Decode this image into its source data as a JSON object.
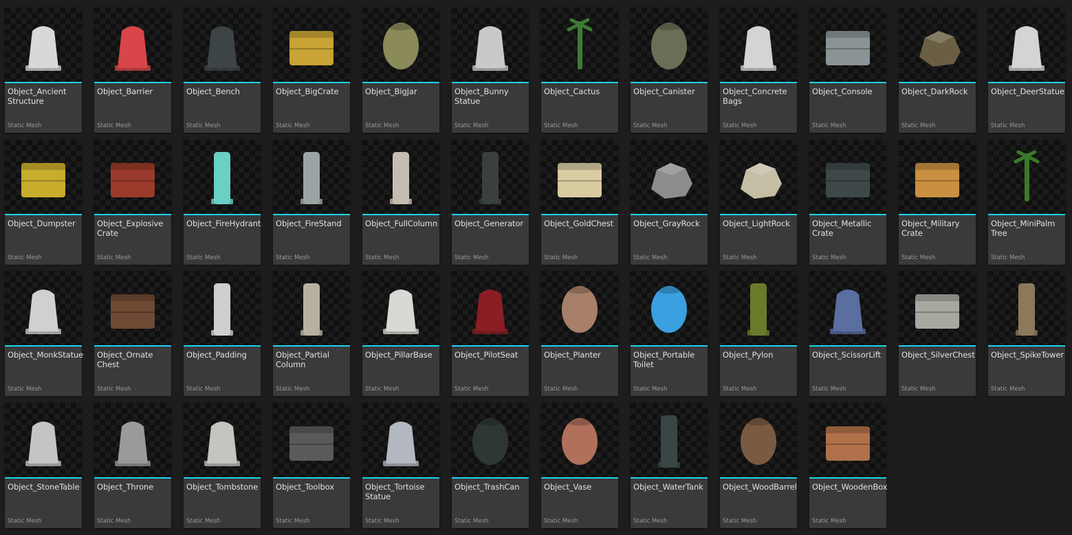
{
  "content_browser": {
    "assets": [
      {
        "name": "Object_Ancient Structure",
        "type": "Static Mesh",
        "icon": "ancient-structure-icon",
        "color": "#d8d8d8"
      },
      {
        "name": "Object_Barrier",
        "type": "Static Mesh",
        "icon": "barrier-icon",
        "color": "#d8454a"
      },
      {
        "name": "Object_Bench",
        "type": "Static Mesh",
        "icon": "bench-icon",
        "color": "#3c4446"
      },
      {
        "name": "Object_BigCrate",
        "type": "Static Mesh",
        "icon": "crate-icon",
        "color": "#c8a335"
      },
      {
        "name": "Object_BigJar",
        "type": "Static Mesh",
        "icon": "jar-icon",
        "color": "#8a8a5a"
      },
      {
        "name": "Object_Bunny Statue",
        "type": "Static Mesh",
        "icon": "bunny-statue-icon",
        "color": "#c9c9c9"
      },
      {
        "name": "Object_Cactus",
        "type": "Static Mesh",
        "icon": "cactus-icon",
        "color": "#3c7a32"
      },
      {
        "name": "Object_Canister",
        "type": "Static Mesh",
        "icon": "canister-icon",
        "color": "#6a6e56"
      },
      {
        "name": "Object_Concrete Bags",
        "type": "Static Mesh",
        "icon": "concrete-bags-icon",
        "color": "#d4d4d4"
      },
      {
        "name": "Object_Console",
        "type": "Static Mesh",
        "icon": "console-icon",
        "color": "#8a9396"
      },
      {
        "name": "Object_DarkRock",
        "type": "Static Mesh",
        "icon": "rock-icon",
        "color": "#6a5e44"
      },
      {
        "name": "Object_DeerStatue",
        "type": "Static Mesh",
        "icon": "deer-statue-icon",
        "color": "#d4d4d4"
      },
      {
        "name": "Object_Dumpster",
        "type": "Static Mesh",
        "icon": "dumpster-icon",
        "color": "#c8ac2c"
      },
      {
        "name": "Object_Explosive Crate",
        "type": "Static Mesh",
        "icon": "explosive-crate-icon",
        "color": "#9a3a2a"
      },
      {
        "name": "Object_FireHydrant",
        "type": "Static Mesh",
        "icon": "fire-hydrant-icon",
        "color": "#6ad0c4"
      },
      {
        "name": "Object_FireStand",
        "type": "Static Mesh",
        "icon": "fire-stand-icon",
        "color": "#9aa4a4"
      },
      {
        "name": "Object_FullColumn",
        "type": "Static Mesh",
        "icon": "column-icon",
        "color": "#c4bdb0"
      },
      {
        "name": "Object_Generator",
        "type": "Static Mesh",
        "icon": "generator-icon",
        "color": "#3a4040"
      },
      {
        "name": "Object_GoldChest",
        "type": "Static Mesh",
        "icon": "chest-icon",
        "color": "#d8cba0"
      },
      {
        "name": "Object_GrayRock",
        "type": "Static Mesh",
        "icon": "rock-icon",
        "color": "#8c8c8c"
      },
      {
        "name": "Object_LightRock",
        "type": "Static Mesh",
        "icon": "rock-icon",
        "color": "#c4bea4"
      },
      {
        "name": "Object_Metallic Crate",
        "type": "Static Mesh",
        "icon": "metallic-crate-icon",
        "color": "#3e4848"
      },
      {
        "name": "Object_Military Crate",
        "type": "Static Mesh",
        "icon": "military-crate-icon",
        "color": "#c89040"
      },
      {
        "name": "Object_MiniPalm Tree",
        "type": "Static Mesh",
        "icon": "palm-tree-icon",
        "color": "#3a7a2a"
      },
      {
        "name": "Object_MonkStatue",
        "type": "Static Mesh",
        "icon": "monk-statue-icon",
        "color": "#d0d0d0"
      },
      {
        "name": "Object_Ornate Chest",
        "type": "Static Mesh",
        "icon": "ornate-chest-icon",
        "color": "#6e4a34"
      },
      {
        "name": "Object_Padding",
        "type": "Static Mesh",
        "icon": "padding-icon",
        "color": "#cfcfcf"
      },
      {
        "name": "Object_Partial Column",
        "type": "Static Mesh",
        "icon": "partial-column-icon",
        "color": "#b8b0a0"
      },
      {
        "name": "Object_PillarBase",
        "type": "Static Mesh",
        "icon": "pillar-base-icon",
        "color": "#d8d8d4"
      },
      {
        "name": "Object_PilotSeat",
        "type": "Static Mesh",
        "icon": "pilot-seat-icon",
        "color": "#8a1e24"
      },
      {
        "name": "Object_Planter",
        "type": "Static Mesh",
        "icon": "planter-icon",
        "color": "#a8806a"
      },
      {
        "name": "Object_Portable Toilet",
        "type": "Static Mesh",
        "icon": "portable-toilet-icon",
        "color": "#3aa0e0"
      },
      {
        "name": "Object_Pylon",
        "type": "Static Mesh",
        "icon": "pylon-icon",
        "color": "#6a7a2a"
      },
      {
        "name": "Object_ScissorLift",
        "type": "Static Mesh",
        "icon": "scissor-lift-icon",
        "color": "#5a6ea0"
      },
      {
        "name": "Object_SilverChest",
        "type": "Static Mesh",
        "icon": "silver-chest-icon",
        "color": "#a8a8a0"
      },
      {
        "name": "Object_SpikeTower",
        "type": "Static Mesh",
        "icon": "spike-tower-icon",
        "color": "#8a7a5a"
      },
      {
        "name": "Object_StoneTable",
        "type": "Static Mesh",
        "icon": "stone-table-icon",
        "color": "#c4c4c4"
      },
      {
        "name": "Object_Throne",
        "type": "Static Mesh",
        "icon": "throne-icon",
        "color": "#9a9a9a"
      },
      {
        "name": "Object_Tombstone",
        "type": "Static Mesh",
        "icon": "tombstone-icon",
        "color": "#c4c4c0"
      },
      {
        "name": "Object_Toolbox",
        "type": "Static Mesh",
        "icon": "toolbox-icon",
        "color": "#5a5a5a"
      },
      {
        "name": "Object_Tortoise Statue",
        "type": "Static Mesh",
        "icon": "tortoise-statue-icon",
        "color": "#b4b8c0"
      },
      {
        "name": "Object_TrashCan",
        "type": "Static Mesh",
        "icon": "trash-can-icon",
        "color": "#2e3636"
      },
      {
        "name": "Object_Vase",
        "type": "Static Mesh",
        "icon": "vase-icon",
        "color": "#b0705a"
      },
      {
        "name": "Object_WaterTank",
        "type": "Static Mesh",
        "icon": "water-tank-icon",
        "color": "#3a4646"
      },
      {
        "name": "Object_WoodBarrel",
        "type": "Static Mesh",
        "icon": "wood-barrel-icon",
        "color": "#7a5a40"
      },
      {
        "name": "Object_WoodenBox",
        "type": "Static Mesh",
        "icon": "wooden-box-icon",
        "color": "#b0704a"
      }
    ],
    "selection_color": "#1ad3f0"
  }
}
